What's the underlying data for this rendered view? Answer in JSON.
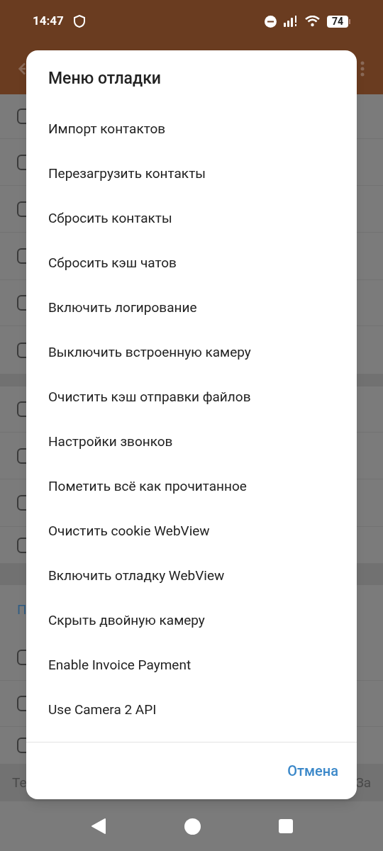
{
  "status_bar": {
    "time": "14:47",
    "battery": "74"
  },
  "background": {
    "section_3_header": "П",
    "footer_left": "Те",
    "footer_right": "За"
  },
  "dialog": {
    "title": "Меню отладки",
    "items": [
      "Импорт контактов",
      "Перезагрузить контакты",
      "Сбросить контакты",
      "Сбросить кэш чатов",
      "Включить логирование",
      "Выключить встроенную камеру",
      "Очистить кэш отправки файлов",
      "Настройки звонков",
      "Пометить всё как прочитанное",
      "Очистить cookie WebView",
      "Включить отладку WebView",
      "Скрыть двойную камеру",
      "Enable Invoice Payment",
      "Use Camera 2 API"
    ],
    "cancel": "Отмена"
  }
}
